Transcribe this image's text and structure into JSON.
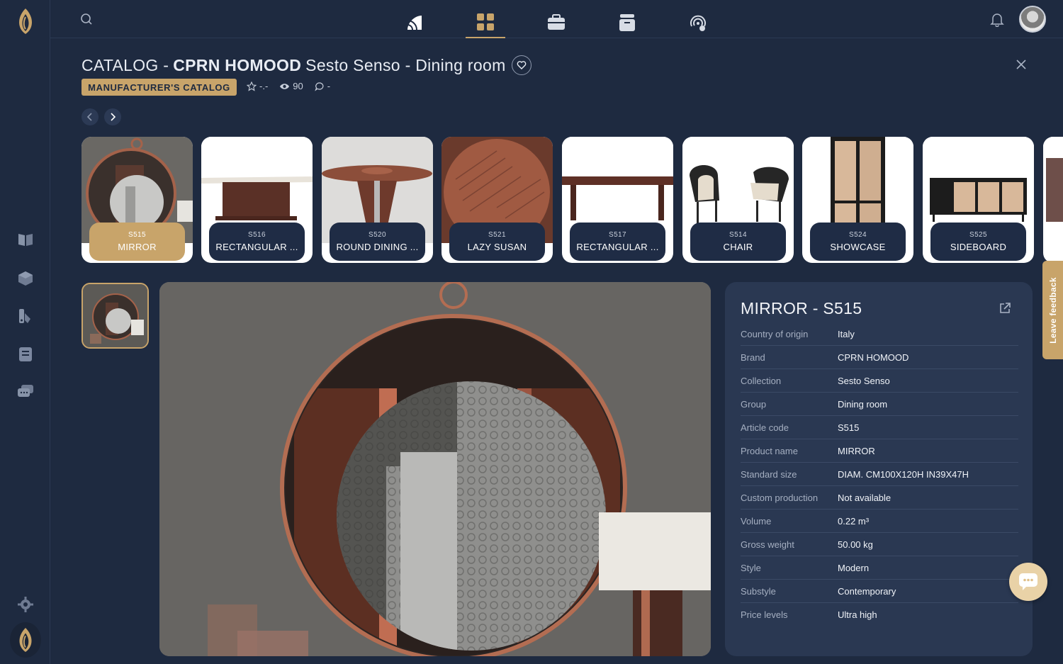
{
  "header": {
    "catalog_prefix": "CATALOG -",
    "brand": "CPRN HOMOOD",
    "collection_title": "Sesto Senso - Dining room",
    "badge": "MANUFACTURER'S CATALOG",
    "rating": "-.-",
    "views": "90",
    "comments": "-"
  },
  "nav": {
    "icons": [
      "feed-icon",
      "grid-icon",
      "briefcase-icon",
      "box-icon",
      "radar-icon"
    ],
    "active": "grid-icon"
  },
  "sidebar": {
    "icons": [
      "catalog-book-icon",
      "cube-icon",
      "swatches-icon",
      "document-icon",
      "chat-bubbles-icon",
      "settings-icon"
    ]
  },
  "carousel": [
    {
      "code": "S515",
      "name": "MIRROR",
      "active": true
    },
    {
      "code": "S516",
      "name": "RECTANGULAR ..."
    },
    {
      "code": "S520",
      "name": "ROUND DINING ..."
    },
    {
      "code": "S521",
      "name": "LAZY SUSAN"
    },
    {
      "code": "S517",
      "name": "RECTANGULAR ..."
    },
    {
      "code": "S514",
      "name": "CHAIR"
    },
    {
      "code": "S524",
      "name": "SHOWCASE"
    },
    {
      "code": "S525",
      "name": "SIDEBOARD"
    }
  ],
  "details": {
    "title": "MIRROR - S515",
    "rows": [
      {
        "k": "Country of origin",
        "v": "Italy"
      },
      {
        "k": "Brand",
        "v": "CPRN HOMOOD"
      },
      {
        "k": "Collection",
        "v": "Sesto Senso"
      },
      {
        "k": "Group",
        "v": "Dining room"
      },
      {
        "k": "Article code",
        "v": "S515"
      },
      {
        "k": "Product name",
        "v": "MIRROR"
      },
      {
        "k": "Standard size",
        "v": "DIAM. CM100X120H IN39X47H"
      },
      {
        "k": "Custom production",
        "v": "Not available"
      },
      {
        "k": "Volume",
        "v": "0.22 m³"
      },
      {
        "k": "Gross weight",
        "v": "50.00 kg"
      },
      {
        "k": "Style",
        "v": "Modern"
      },
      {
        "k": "Substyle",
        "v": "Contemporary"
      },
      {
        "k": "Price levels",
        "v": "Ultra high"
      }
    ]
  },
  "feedback_label": "Leave feedback",
  "colors": {
    "accent": "#c8a46a",
    "background": "#1e2a40",
    "panel": "#2a3852"
  }
}
